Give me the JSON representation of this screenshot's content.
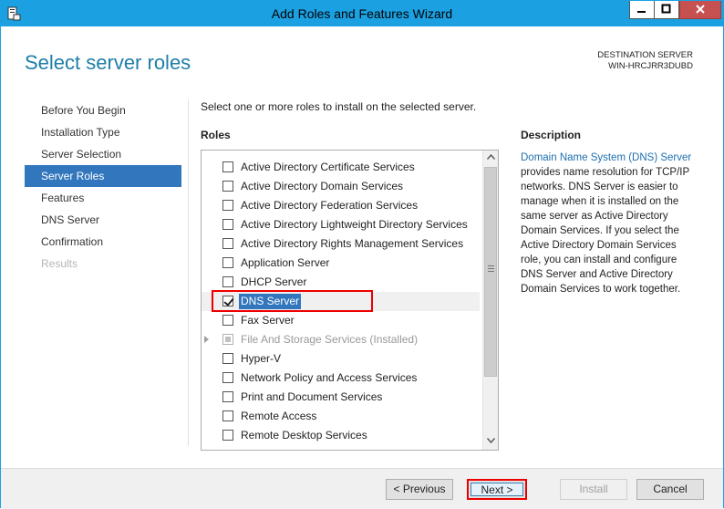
{
  "window": {
    "title": "Add Roles and Features Wizard",
    "icons": {
      "app": "server-manager-icon",
      "minimize": "minimize-icon",
      "maximize": "maximize-icon",
      "close": "close-icon"
    }
  },
  "page": {
    "heading": "Select server roles",
    "destination_label": "DESTINATION SERVER",
    "destination_server": "WIN-HRCJRR3DUBD",
    "instruction": "Select one or more roles to install on the selected server."
  },
  "nav": {
    "items": [
      {
        "label": "Before You Begin",
        "state": "normal"
      },
      {
        "label": "Installation Type",
        "state": "normal"
      },
      {
        "label": "Server Selection",
        "state": "normal"
      },
      {
        "label": "Server Roles",
        "state": "selected"
      },
      {
        "label": "Features",
        "state": "normal"
      },
      {
        "label": "DNS Server",
        "state": "normal"
      },
      {
        "label": "Confirmation",
        "state": "normal"
      },
      {
        "label": "Results",
        "state": "disabled"
      }
    ]
  },
  "roles": {
    "label": "Roles",
    "items": [
      {
        "label": "Active Directory Certificate Services",
        "checked": false
      },
      {
        "label": "Active Directory Domain Services",
        "checked": false
      },
      {
        "label": "Active Directory Federation Services",
        "checked": false
      },
      {
        "label": "Active Directory Lightweight Directory Services",
        "checked": false
      },
      {
        "label": "Active Directory Rights Management Services",
        "checked": false
      },
      {
        "label": "Application Server",
        "checked": false
      },
      {
        "label": "DHCP Server",
        "checked": false
      },
      {
        "label": "DNS Server",
        "checked": true
      },
      {
        "label": "Fax Server",
        "checked": false
      },
      {
        "label": "File And Storage Services (Installed)",
        "checked": "partial"
      },
      {
        "label": "Hyper-V",
        "checked": false
      },
      {
        "label": "Network Policy and Access Services",
        "checked": false
      },
      {
        "label": "Print and Document Services",
        "checked": false
      },
      {
        "label": "Remote Access",
        "checked": false
      },
      {
        "label": "Remote Desktop Services",
        "checked": false
      }
    ]
  },
  "description": {
    "label": "Description",
    "link_text": "Domain Name System (DNS) Server",
    "body": " provides name resolution for TCP/IP networks. DNS Server is easier to manage when it is installed on the same server as Active Directory Domain Services. If you select the Active Directory Domain Services role, you can install and configure DNS Server and Active Directory Domain Services to work together."
  },
  "buttons": {
    "previous": "< Previous",
    "next": "Next >",
    "install": "Install",
    "cancel": "Cancel"
  },
  "colors": {
    "titlebar": "#1ba1e2",
    "accent": "#3277bd",
    "heading": "#1e7ea8",
    "highlight": "#e00000"
  }
}
